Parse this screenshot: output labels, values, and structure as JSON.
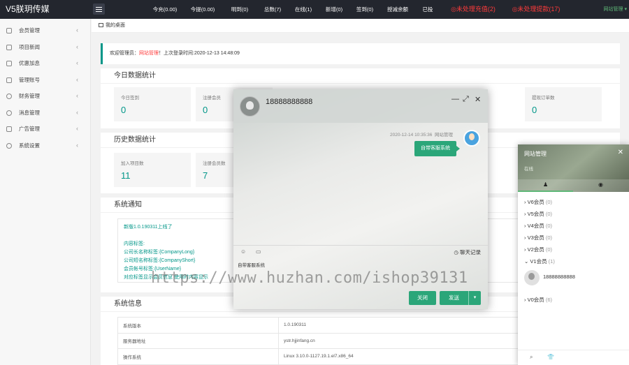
{
  "app": {
    "logo": "V5朕玥传媒"
  },
  "topbar": {
    "stats": [
      "今充(0.00)",
      "今提(0.00)",
      "明到(0)",
      "总数(7)",
      "在线(1)",
      "新增(0)",
      "签到(0)",
      "授减余额",
      "已投"
    ],
    "alerts": [
      "◎未处理充值(2)",
      "◎未处理提款(17)"
    ],
    "admin": "网站管理 ▾"
  },
  "sidebar": {
    "items": [
      {
        "label": "会员管理",
        "icon": "user-icon"
      },
      {
        "label": "项目新闻",
        "icon": "car-icon"
      },
      {
        "label": "优惠加息",
        "icon": "card-icon"
      },
      {
        "label": "管理账号",
        "icon": "account-icon"
      },
      {
        "label": "财务管理",
        "icon": "finance-icon"
      },
      {
        "label": "消息管理",
        "icon": "message-icon"
      },
      {
        "label": "广告管理",
        "icon": "ad-icon"
      },
      {
        "label": "系统设置",
        "icon": "gear-icon"
      }
    ]
  },
  "breadcrumb": {
    "label": "我的桌面"
  },
  "welcome": {
    "prefix": "欢迎管理员：",
    "name": "网站管理",
    "suffix": "！上次登录时间:2020-12-13 14:48:09"
  },
  "today": {
    "title": "今日数据统计",
    "stats": [
      {
        "label": "今日签到",
        "value": "0"
      },
      {
        "label": "注册会员",
        "value": "0"
      },
      {
        "label": "提现订单数",
        "value": "0"
      }
    ]
  },
  "history": {
    "title": "历史数据统计",
    "stats": [
      {
        "label": "加入项目数",
        "value": "11"
      },
      {
        "label": "注册会员数",
        "value": "7"
      }
    ]
  },
  "notice": {
    "title": "系统通知",
    "lines": [
      "新版1.0.190311上线了",
      "",
      "内容标签:",
      "公司长名称标签:{CompanyLong}",
      "公司短名称标签:{CompanyShort}",
      "会员帐号标签:{UserName}",
      "对应标签显示会员信息 使用时内容显示"
    ]
  },
  "sysinfo": {
    "title": "系统信息",
    "rows": [
      {
        "k": "系统版本",
        "v": "1.0.190311"
      },
      {
        "k": "服务器地址",
        "v": "ystr.hjjinfang.cn"
      },
      {
        "k": "操作系统",
        "v": "Linux 3.10.0-1127.19.1.el7.x86_64"
      }
    ]
  },
  "chat": {
    "name": "18888888888",
    "controls": {
      "minimize": "—",
      "maximize": "⤢",
      "close": "✕"
    },
    "message": {
      "time": "2020-12-14 10:35:36",
      "sender": "网站管理",
      "text": "自带客服系统"
    },
    "tools": {
      "emoji": "☺",
      "image": "▭",
      "history": "聊天记录",
      "history_icon": "◷"
    },
    "input_text": "自带客服系统",
    "buttons": {
      "close": "关闭",
      "send": "发送",
      "caret": "▾"
    }
  },
  "watermark": "https://www.huzhan.com/ishop39131",
  "contacts": {
    "title": "网站管理",
    "subtitle": "在线",
    "close": "✕",
    "tabs": {
      "friends": "♟",
      "groups": "◉"
    },
    "groups": [
      {
        "label": "V6会员",
        "count": "(0)",
        "arrow": "›"
      },
      {
        "label": "V5会员",
        "count": "(0)",
        "arrow": "›"
      },
      {
        "label": "V4会员",
        "count": "(0)",
        "arrow": "›"
      },
      {
        "label": "V3会员",
        "count": "(0)",
        "arrow": "›"
      },
      {
        "label": "V2会员",
        "count": "(0)",
        "arrow": "›"
      },
      {
        "label": "V1会员",
        "count": "(1)",
        "arrow": "⌄"
      }
    ],
    "member": "18888888888",
    "group_v0": {
      "label": "V0会员",
      "count": "(6)",
      "arrow": "›"
    },
    "footer": {
      "search": "⌕",
      "skin": "👕"
    }
  }
}
